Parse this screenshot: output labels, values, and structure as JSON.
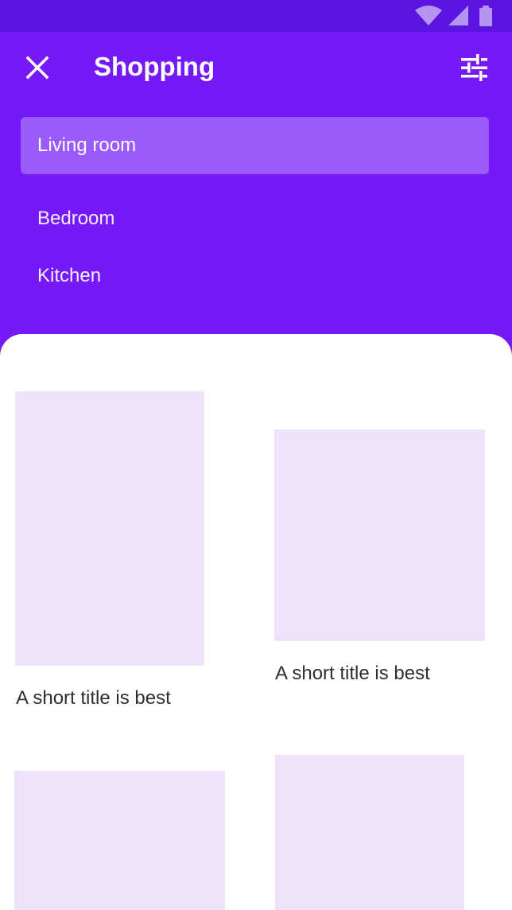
{
  "status_bar": {
    "icons": [
      "wifi-icon",
      "cellular-signal-icon",
      "battery-icon"
    ],
    "color": "#5C14E1"
  },
  "app_bar": {
    "title": "Shopping",
    "close_icon": "close-icon",
    "filter_icon": "tune-icon"
  },
  "menu": {
    "items": [
      {
        "label": "Living room",
        "selected": true
      },
      {
        "label": "Bedroom",
        "selected": false
      },
      {
        "label": "Kitchen",
        "selected": false
      }
    ]
  },
  "cards": [
    {
      "title": "A short title is best"
    },
    {
      "title": "A short title is best"
    },
    {
      "title": ""
    },
    {
      "title": ""
    }
  ],
  "colors": {
    "primary": "#7519F8",
    "primary_dark": "#5C14E1",
    "selected_item": "#9A5BFA",
    "image_placeholder": "#EFE3FC"
  }
}
